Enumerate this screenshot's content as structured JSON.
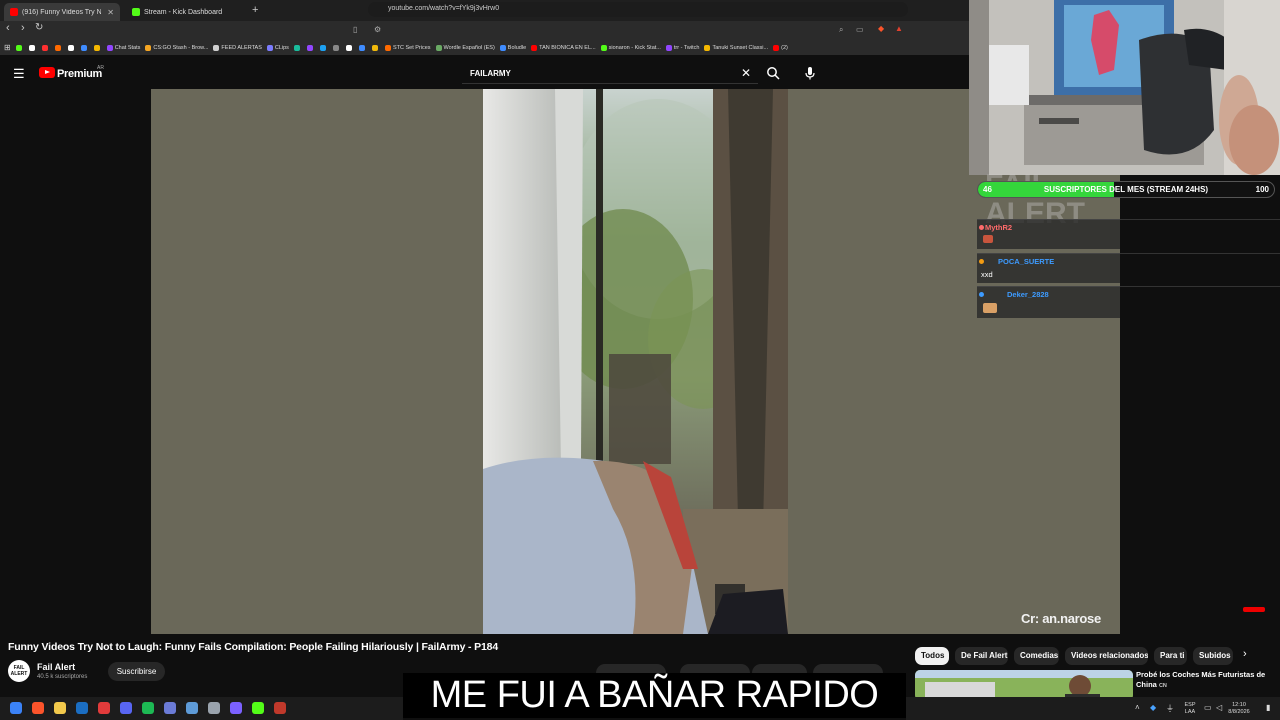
{
  "browser": {
    "tabs": [
      {
        "label": "(916) Funny Videos Try Not to",
        "active": true,
        "favicon_color": "#ff0000"
      },
      {
        "label": "Stream - Kick Dashboard",
        "active": false,
        "favicon_color": "#53fc18"
      }
    ],
    "url": "youtube.com/watch?v=fYk9j3vHrw0",
    "bookmarks": [
      {
        "label": "",
        "color": "#53fc18"
      },
      {
        "label": "",
        "color": "#ffffff"
      },
      {
        "label": "",
        "color": "#ff3030"
      },
      {
        "label": "",
        "color": "#ff6a00"
      },
      {
        "label": "",
        "color": "#ffffff"
      },
      {
        "label": "",
        "color": "#3f8cff"
      },
      {
        "label": "",
        "color": "#f5b800"
      },
      {
        "label": "Chat Stats",
        "color": "#9146ff"
      },
      {
        "label": "CS:GO Stash - Brow...",
        "color": "#f5a623"
      },
      {
        "label": "FEED ALERTAS",
        "color": "#d0d0d0"
      },
      {
        "label": "CLips",
        "color": "#7c7cff"
      },
      {
        "label": "",
        "color": "#1abc9c"
      },
      {
        "label": "",
        "color": "#9146ff"
      },
      {
        "label": "",
        "color": "#1da1f2"
      },
      {
        "label": "",
        "color": "#888888"
      },
      {
        "label": "",
        "color": "#ffffff"
      },
      {
        "label": "",
        "color": "#3f8cff"
      },
      {
        "label": "",
        "color": "#f0b90b"
      },
      {
        "label": "STC Set Prices",
        "color": "#ff6a00"
      },
      {
        "label": "Wordle Español (ES)",
        "color": "#6aaa64"
      },
      {
        "label": "Boludle",
        "color": "#3f8cff"
      },
      {
        "label": "TAN BIONICA EN EL...",
        "color": "#ff0000"
      },
      {
        "label": "sionaron - Kick Stat...",
        "color": "#53fc18"
      },
      {
        "label": "trr - Twitch",
        "color": "#9146ff"
      },
      {
        "label": "Tanuki Sunset Classi...",
        "color": "#f5b800"
      },
      {
        "label": "(2)",
        "color": "#ff0000"
      }
    ]
  },
  "youtube": {
    "brand": "Premium",
    "brand_sup": "AR",
    "search_value": "FAILARMY",
    "video_title": "Funny Videos Try Not to Laugh: Funny Fails Compilation: People Failing Hilariously | FailArmy - P184",
    "channel_name": "Fail Alert",
    "channel_subs": "40.5 k suscriptores",
    "avatar_text": "FAIL ALERT",
    "subscribe_label": "Suscribirse",
    "watermark": "Cr: an.narose",
    "chips": [
      {
        "label": "Todos",
        "active": true
      },
      {
        "label": "De Fail Alert",
        "active": false
      },
      {
        "label": "Comedias",
        "active": false
      },
      {
        "label": "Videos relacionados",
        "active": false
      },
      {
        "label": "Para ti",
        "active": false
      },
      {
        "label": "Subidos r",
        "active": false
      }
    ],
    "recommended_title": "Probé los Coches Más Futuristas de China",
    "recommended_suffix": "CN"
  },
  "overlay": {
    "goal_current": "46",
    "goal_max": "100",
    "goal_progress": 0.46,
    "goal_label": "SUSCRIPTORES DEL MES (STREAM 24HS)",
    "bg_text": "FAIL ALERT",
    "chat": [
      {
        "user": "MythR2",
        "user_color": "#ff6b6b",
        "message": "",
        "emote_color": "#c8553d"
      },
      {
        "user": "POCA_SUERTE",
        "user_color": "#3d9bff",
        "message": "xxd",
        "emote_color": ""
      },
      {
        "user": "Deker_2828",
        "user_color": "#3d9bff",
        "message": "",
        "emote_color": "#d9a066"
      }
    ],
    "subtitle": "ME FUI A BAÑAR RAPIDO"
  },
  "taskbar": {
    "lang_1": "ESP",
    "lang_2": "LAA",
    "time": "12:10",
    "date": "8/8/2026"
  }
}
